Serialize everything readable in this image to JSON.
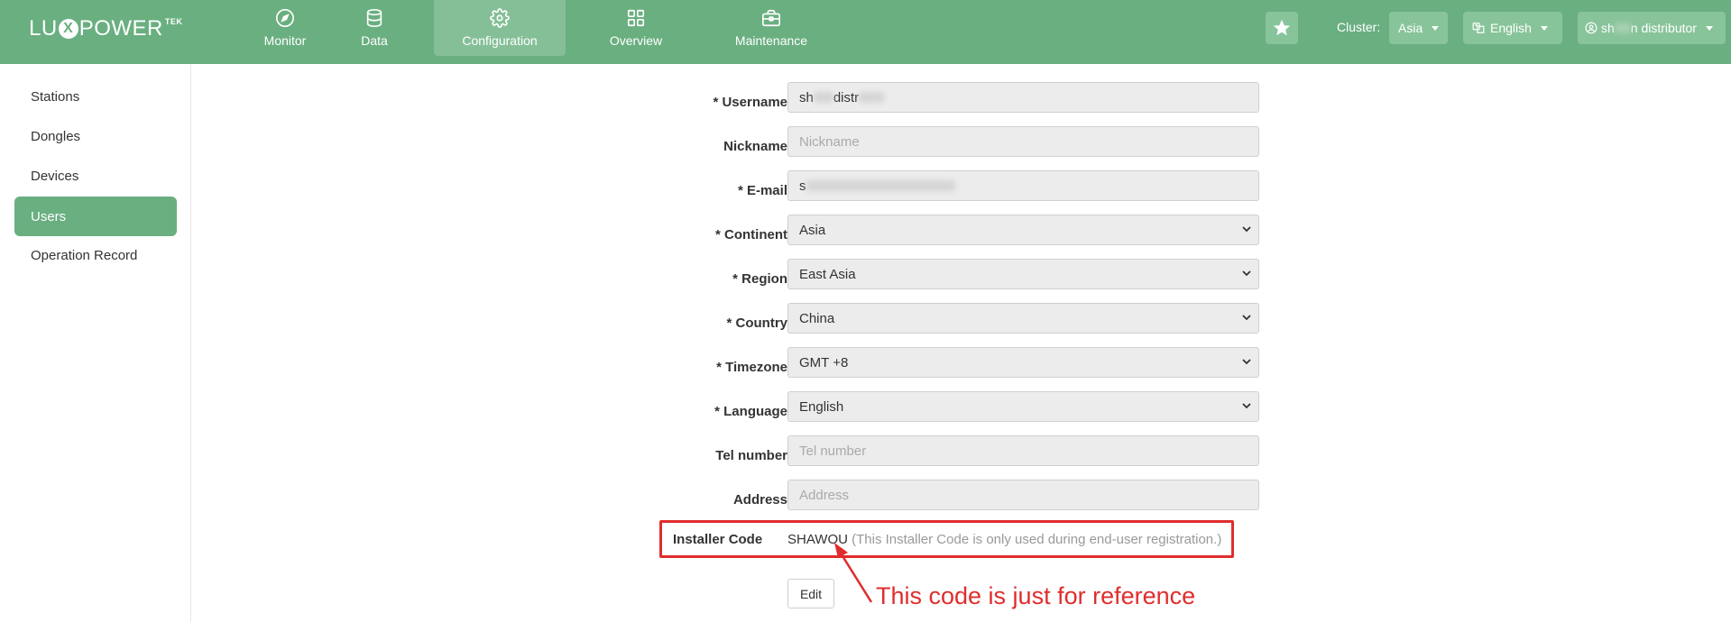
{
  "brand": {
    "part1": "LU",
    "x": "X",
    "part2": "POWER",
    "tek": "TEK"
  },
  "nav": [
    {
      "label": "Monitor",
      "icon": "compass-icon"
    },
    {
      "label": "Data",
      "icon": "database-icon"
    },
    {
      "label": "Configuration",
      "icon": "gear-icon",
      "active": true
    },
    {
      "label": "Overview",
      "icon": "grid-icon"
    },
    {
      "label": "Maintenance",
      "icon": "toolbox-icon"
    }
  ],
  "header": {
    "cluster_label": "Cluster:",
    "cluster_value": "Asia",
    "language_value": "English",
    "user_prefix": "sh",
    "user_suffix": "n distributor"
  },
  "sidebar": {
    "items": [
      {
        "label": "Stations"
      },
      {
        "label": "Dongles"
      },
      {
        "label": "Devices"
      },
      {
        "label": "Users",
        "active": true
      },
      {
        "label": "Operation Record"
      }
    ]
  },
  "form": {
    "username": {
      "label": "* Username",
      "value_prefix": "sh",
      "value_mid": "distr"
    },
    "nickname": {
      "label": "Nickname",
      "placeholder": "Nickname"
    },
    "email": {
      "label": "* E-mail",
      "value_prefix": "s"
    },
    "continent": {
      "label": "* Continent",
      "value": "Asia"
    },
    "region": {
      "label": "* Region",
      "value": "East Asia"
    },
    "country": {
      "label": "* Country",
      "value": "China"
    },
    "timezone": {
      "label": "* Timezone",
      "value": "GMT +8"
    },
    "language": {
      "label": "* Language",
      "value": "English"
    },
    "tel": {
      "label": "Tel number",
      "placeholder": "Tel number"
    },
    "address": {
      "label": "Address",
      "placeholder": "Address"
    },
    "installer": {
      "label": "Installer Code",
      "code": "SHAWOU",
      "note": " (This Installer Code is only used during end-user registration.)"
    },
    "edit_label": "Edit"
  },
  "annotation": {
    "text": "This code is just for reference",
    "color": "#e02d2d"
  },
  "colors": {
    "brand_green": "#6aaf80",
    "active_nav": "#85bf97",
    "highlight_red": "#e02d2d"
  }
}
